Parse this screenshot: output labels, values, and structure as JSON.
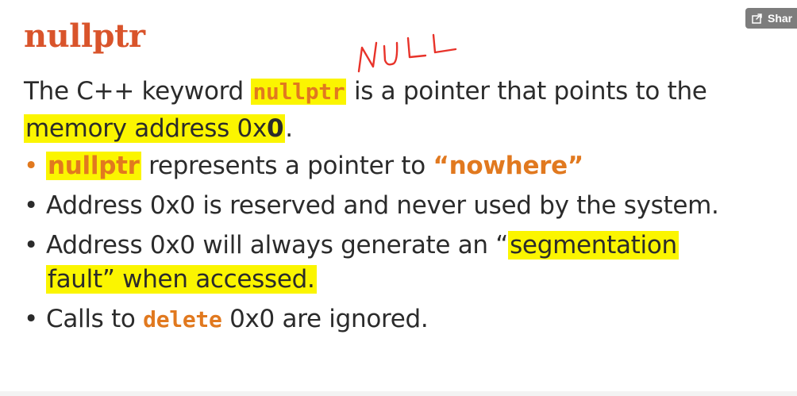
{
  "slide": {
    "title": "nullptr",
    "handwritten_note": "NULL",
    "intro": {
      "part1": "The C++ keyword ",
      "keyword": "nullptr",
      "part2": " is a pointer that points to the ",
      "highlight_text": "memory address 0x",
      "highlight_bold": "0",
      "end": "."
    },
    "bullets": [
      {
        "keyword": "nullptr",
        "text": " represents a pointer to ",
        "emphasis": "“nowhere”"
      },
      {
        "text": "Address 0x0 is reserved and never used by the system."
      },
      {
        "text": "Address 0x0 will always generate an “",
        "highlight_1": "segmentation",
        "highlight_2": "fault” when accessed."
      },
      {
        "prefix": "Calls to ",
        "keyword": "delete",
        "suffix": " 0x0 are ignored."
      }
    ]
  },
  "overlay": {
    "share_label": "Shar",
    "share_icon": "share-icon"
  },
  "colors": {
    "title": "#d9542b",
    "keyword": "#e1791f",
    "highlight": "#fbf500",
    "text": "#2b2b2b",
    "annotation": "#e8332a"
  }
}
